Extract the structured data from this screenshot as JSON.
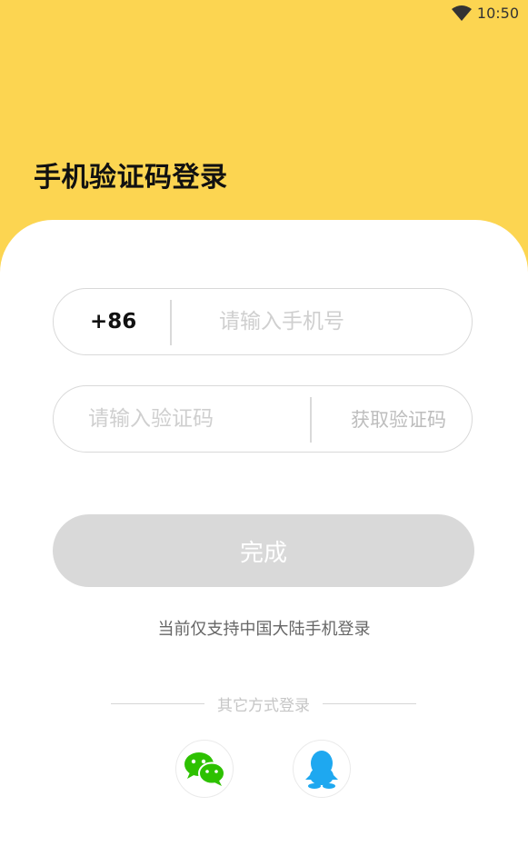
{
  "status_bar": {
    "time": "10:50",
    "wifi_icon": "wifi-icon"
  },
  "header": {
    "title": "手机验证码登录"
  },
  "form": {
    "country_code": "+86",
    "phone_placeholder": "请输入手机号",
    "code_placeholder": "请输入验证码",
    "get_code_label": "获取验证码",
    "submit_label": "完成"
  },
  "notice": "当前仅支持中国大陆手机登录",
  "other_login": {
    "label": "其它方式登录",
    "options": [
      {
        "icon": "wechat-icon"
      },
      {
        "icon": "qq-icon"
      }
    ]
  },
  "colors": {
    "background": "#FCD551",
    "card": "#FFFFFF",
    "field_border": "#D9D9D9",
    "button_disabled": "#D9D9D9",
    "wechat": "#2DC100",
    "qq": "#1EA8F0"
  }
}
